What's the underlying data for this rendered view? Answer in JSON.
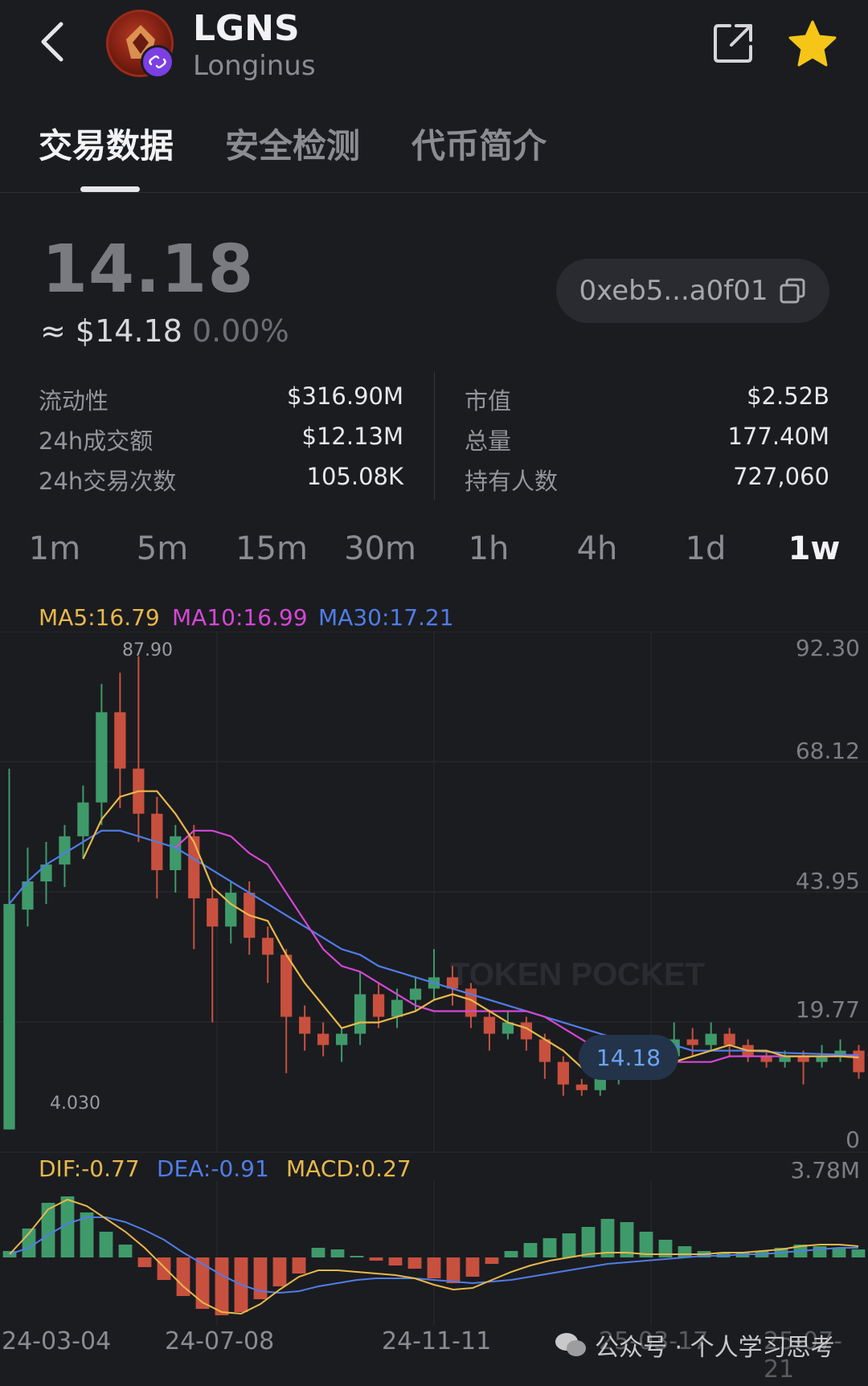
{
  "header": {
    "symbol": "LGNS",
    "name": "Longinus",
    "icons": [
      "back-icon",
      "share-icon",
      "star-icon"
    ],
    "star_color": "#f5c518"
  },
  "tabs": [
    {
      "label": "交易数据",
      "active": true
    },
    {
      "label": "安全检测",
      "active": false
    },
    {
      "label": "代币简介",
      "active": false
    }
  ],
  "price": {
    "value": "14.18",
    "usd": "≈ $14.18",
    "change": "0.00%",
    "address": "0xeb5...a0f01"
  },
  "stats": {
    "left": [
      {
        "label": "流动性",
        "value": "$316.90M"
      },
      {
        "label": "24h成交额",
        "value": "$12.13M"
      },
      {
        "label": "24h交易次数",
        "value": "105.08K"
      }
    ],
    "right": [
      {
        "label": "市值",
        "value": "$2.52B"
      },
      {
        "label": "总量",
        "value": "177.40M"
      },
      {
        "label": "持有人数",
        "value": "727,060"
      }
    ]
  },
  "intervals": [
    {
      "label": "1m",
      "active": false
    },
    {
      "label": "5m",
      "active": false
    },
    {
      "label": "15m",
      "active": false
    },
    {
      "label": "30m",
      "active": false
    },
    {
      "label": "1h",
      "active": false
    },
    {
      "label": "4h",
      "active": false
    },
    {
      "label": "1d",
      "active": false
    },
    {
      "label": "1w",
      "active": true
    }
  ],
  "ma_legend": {
    "ma5": "MA5:16.79",
    "ma10": "MA10:16.99",
    "ma30": "MA30:17.21"
  },
  "price_axis": {
    "labels": [
      "92.30",
      "68.12",
      "43.95",
      "19.77",
      "0"
    ],
    "high_label": "87.90",
    "low_label": "4.030",
    "current_label": "14.18"
  },
  "macd_legend": {
    "dif": "DIF:-0.77",
    "dea": "DEA:-0.91",
    "macd": "MACD:0.27",
    "right_label": "3.78M"
  },
  "x_axis": {
    "labels": [
      "24-03-04",
      "24-07-08",
      "24-11-11",
      "25-03-17",
      "25-07-21"
    ]
  },
  "colors": {
    "up": "#3f9a6a",
    "down": "#c8503e",
    "ma5": "#e8b84a",
    "ma10": "#d447d6",
    "ma30": "#4f7de8"
  },
  "watermark": "公众号 · 个人学习思考",
  "chart_data": {
    "type": "candlestick",
    "ylim": [
      0,
      92.3
    ],
    "y_ticks": [
      92.3,
      68.12,
      43.95,
      19.77,
      0
    ],
    "candles": [
      {
        "o": 4.03,
        "c": 44,
        "h": 68,
        "l": 4.03
      },
      {
        "o": 43,
        "c": 48,
        "h": 54,
        "l": 40
      },
      {
        "o": 48,
        "c": 51,
        "h": 55,
        "l": 44
      },
      {
        "o": 51,
        "c": 56,
        "h": 58,
        "l": 47
      },
      {
        "o": 56,
        "c": 62,
        "h": 65,
        "l": 52
      },
      {
        "o": 62,
        "c": 78,
        "h": 83,
        "l": 58
      },
      {
        "o": 78,
        "c": 68,
        "h": 85,
        "l": 61
      },
      {
        "o": 68,
        "c": 60,
        "h": 87.9,
        "l": 55
      },
      {
        "o": 60,
        "c": 50,
        "h": 63,
        "l": 45
      },
      {
        "o": 50,
        "c": 56,
        "h": 58,
        "l": 46
      },
      {
        "o": 56,
        "c": 45,
        "h": 58,
        "l": 36
      },
      {
        "o": 45,
        "c": 40,
        "h": 47,
        "l": 23
      },
      {
        "o": 40,
        "c": 46,
        "h": 48,
        "l": 37
      },
      {
        "o": 46,
        "c": 38,
        "h": 48,
        "l": 35
      },
      {
        "o": 38,
        "c": 35,
        "h": 40,
        "l": 30
      },
      {
        "o": 35,
        "c": 24,
        "h": 36,
        "l": 14
      },
      {
        "o": 24,
        "c": 21,
        "h": 26,
        "l": 18
      },
      {
        "o": 21,
        "c": 19,
        "h": 23,
        "l": 17
      },
      {
        "o": 19,
        "c": 21,
        "h": 22,
        "l": 16
      },
      {
        "o": 21,
        "c": 28,
        "h": 32,
        "l": 19
      },
      {
        "o": 28,
        "c": 24,
        "h": 30,
        "l": 22
      },
      {
        "o": 24,
        "c": 27,
        "h": 29,
        "l": 22
      },
      {
        "o": 27,
        "c": 29,
        "h": 31,
        "l": 25
      },
      {
        "o": 29,
        "c": 31,
        "h": 36,
        "l": 27
      },
      {
        "o": 31,
        "c": 29,
        "h": 33,
        "l": 26
      },
      {
        "o": 29,
        "c": 24,
        "h": 30,
        "l": 22
      },
      {
        "o": 24,
        "c": 21,
        "h": 25,
        "l": 18
      },
      {
        "o": 21,
        "c": 23,
        "h": 25,
        "l": 20
      },
      {
        "o": 23,
        "c": 20,
        "h": 24,
        "l": 18
      },
      {
        "o": 20,
        "c": 16,
        "h": 21,
        "l": 13
      },
      {
        "o": 16,
        "c": 12,
        "h": 17,
        "l": 10
      },
      {
        "o": 12,
        "c": 11,
        "h": 13,
        "l": 10
      },
      {
        "o": 11,
        "c": 13,
        "h": 14,
        "l": 10
      },
      {
        "o": 13,
        "c": 15,
        "h": 16,
        "l": 12
      },
      {
        "o": 15,
        "c": 18,
        "h": 20,
        "l": 14
      },
      {
        "o": 18,
        "c": 17,
        "h": 20,
        "l": 15
      },
      {
        "o": 17,
        "c": 20,
        "h": 23,
        "l": 16
      },
      {
        "o": 20,
        "c": 19,
        "h": 22,
        "l": 17
      },
      {
        "o": 19,
        "c": 21,
        "h": 23,
        "l": 18
      },
      {
        "o": 21,
        "c": 19,
        "h": 22,
        "l": 17
      },
      {
        "o": 19,
        "c": 17,
        "h": 20,
        "l": 16
      },
      {
        "o": 17,
        "c": 16,
        "h": 18,
        "l": 15
      },
      {
        "o": 16,
        "c": 17,
        "h": 18,
        "l": 15
      },
      {
        "o": 17,
        "c": 16,
        "h": 18,
        "l": 12
      },
      {
        "o": 16,
        "c": 17,
        "h": 19,
        "l": 15
      },
      {
        "o": 17,
        "c": 18,
        "h": 20,
        "l": 16
      },
      {
        "o": 18,
        "c": 14.18,
        "h": 19,
        "l": 13
      }
    ],
    "ma5": [
      null,
      null,
      null,
      null,
      52,
      59,
      63,
      64,
      64,
      60,
      55,
      47,
      44,
      42,
      41,
      35,
      30,
      26,
      22,
      23,
      23,
      24,
      25,
      27,
      28,
      27,
      25,
      23,
      22,
      20,
      18,
      15,
      14,
      14,
      15,
      15,
      16,
      17,
      18,
      19,
      18,
      18,
      17,
      17,
      17,
      17,
      16.79
    ],
    "ma10": [
      null,
      null,
      null,
      null,
      null,
      null,
      null,
      null,
      null,
      54,
      57,
      57,
      56,
      53,
      51,
      46,
      41,
      36,
      33,
      32,
      30,
      28,
      26,
      25,
      25,
      25,
      25,
      25,
      25,
      24,
      22,
      20,
      18,
      17,
      17,
      16,
      16,
      16,
      16,
      17,
      17,
      17,
      17,
      17,
      17,
      17,
      16.99
    ],
    "ma30": [
      44,
      48,
      51,
      53,
      55,
      57,
      57,
      56,
      55,
      54,
      52,
      50,
      48,
      46,
      44,
      42,
      40,
      38,
      36,
      35,
      33,
      32,
      31,
      30,
      29,
      28,
      27,
      26,
      25,
      24,
      23,
      22,
      21,
      20,
      20,
      19,
      19,
      18,
      18,
      18,
      18,
      17.8,
      17.6,
      17.5,
      17.4,
      17.3,
      17.21
    ],
    "macd": {
      "hist": [
        0.4,
        1.8,
        3.4,
        3.8,
        2.8,
        1.6,
        0.8,
        -0.6,
        -1.4,
        -2.4,
        -3.2,
        -3.6,
        -3.4,
        -2.6,
        -1.8,
        -1.0,
        0.6,
        0.5,
        0.1,
        -0.2,
        -0.5,
        -0.7,
        -1.3,
        -1.6,
        -1.2,
        -0.4,
        0.4,
        0.9,
        1.2,
        1.5,
        1.9,
        2.4,
        2.2,
        1.6,
        1.1,
        0.7,
        0.4,
        0.3,
        0.3,
        0.4,
        0.6,
        0.8,
        0.7,
        0.6,
        0.5
      ],
      "dif": [
        0.2,
        1.5,
        3.0,
        3.6,
        3.2,
        2.4,
        1.6,
        0.6,
        -0.6,
        -1.8,
        -2.8,
        -3.4,
        -3.5,
        -2.9,
        -2.0,
        -1.2,
        -0.8,
        -0.8,
        -0.9,
        -1.0,
        -1.1,
        -1.3,
        -1.7,
        -2.0,
        -1.9,
        -1.4,
        -0.9,
        -0.5,
        -0.2,
        0.0,
        0.2,
        0.3,
        0.3,
        0.2,
        0.2,
        0.2,
        0.2,
        0.3,
        0.3,
        0.4,
        0.5,
        0.7,
        0.8,
        0.8,
        0.7
      ],
      "dea": [
        0.2,
        0.6,
        1.4,
        2.1,
        2.5,
        2.5,
        2.2,
        1.7,
        1.1,
        0.3,
        -0.4,
        -1.1,
        -1.7,
        -2.1,
        -2.2,
        -2.1,
        -1.8,
        -1.6,
        -1.4,
        -1.3,
        -1.3,
        -1.3,
        -1.4,
        -1.5,
        -1.6,
        -1.5,
        -1.4,
        -1.2,
        -1.0,
        -0.8,
        -0.6,
        -0.4,
        -0.3,
        -0.2,
        -0.1,
        0.0,
        0.1,
        0.1,
        0.2,
        0.2,
        0.3,
        0.4,
        0.5,
        0.6,
        0.6
      ]
    }
  }
}
